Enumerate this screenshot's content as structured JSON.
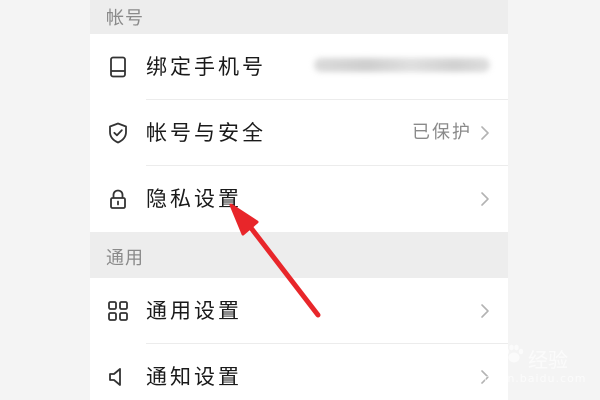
{
  "sections": {
    "account": {
      "header": "帐号"
    },
    "general": {
      "header": "通用"
    }
  },
  "rows": {
    "bind_phone": {
      "label": "绑定手机号",
      "icon": "phone-icon"
    },
    "account_security": {
      "label": "帐号与安全",
      "value": "已保护",
      "icon": "shield-icon"
    },
    "privacy": {
      "label": "隐私设置",
      "icon": "lock-icon"
    },
    "general_settings": {
      "label": "通用设置",
      "icon": "grid-icon"
    },
    "notification": {
      "label": "通知设置",
      "icon": "speaker-icon"
    }
  },
  "annotation": {
    "color": "#e8262a"
  },
  "watermark": {
    "brand": "Bai",
    "brand_cn": "经验",
    "url": "jingyan.baidu.com"
  }
}
